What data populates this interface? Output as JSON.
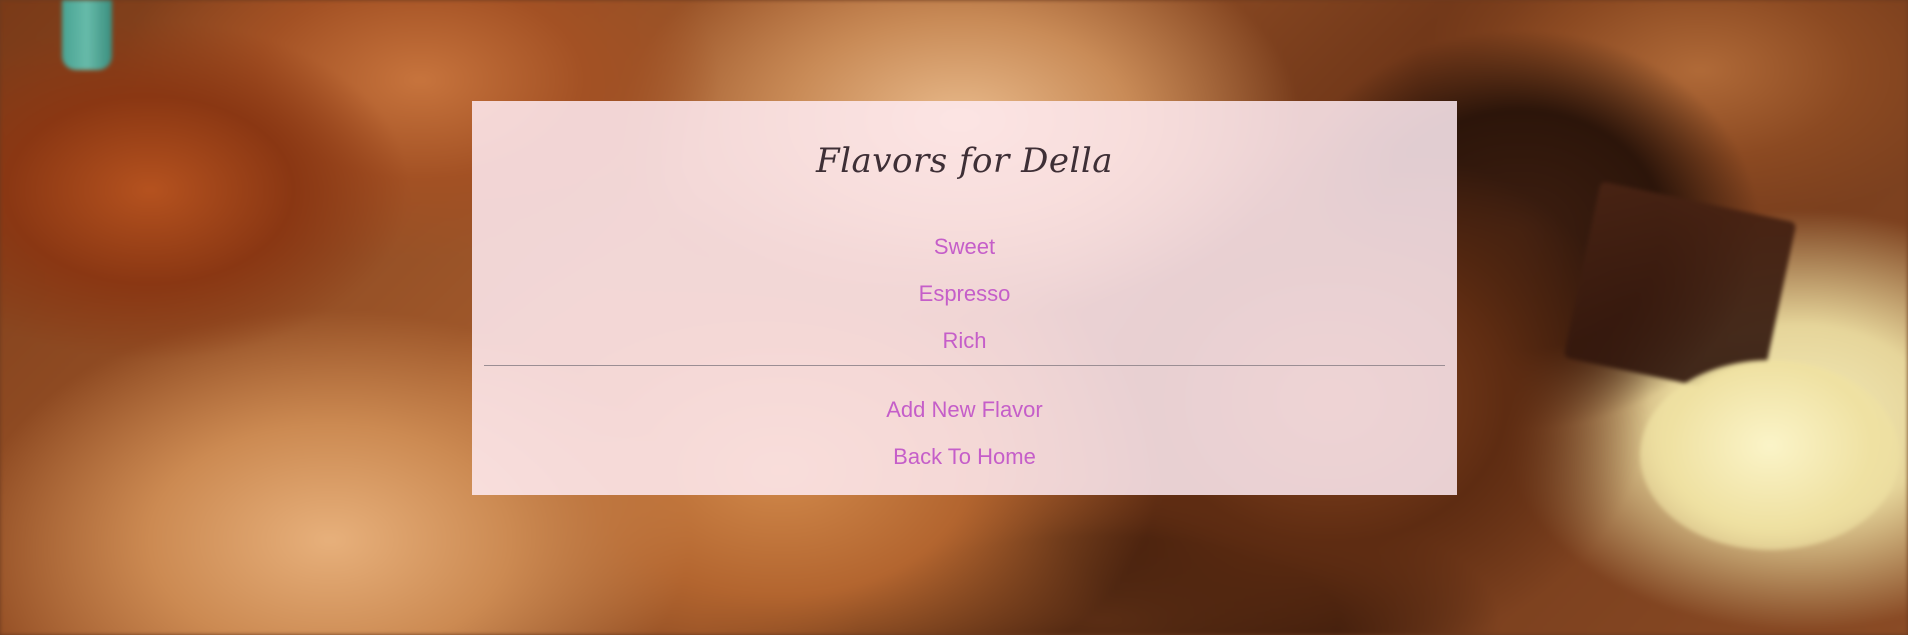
{
  "page": {
    "title": "Flavors for Della"
  },
  "flavors": [
    {
      "label": "Sweet"
    },
    {
      "label": "Espresso"
    },
    {
      "label": "Rich"
    }
  ],
  "actions": {
    "add_flavor_label": "Add New Flavor",
    "back_home_label": "Back To Home"
  },
  "colors": {
    "card_background": "#ffebf2",
    "link": "#c55ec9",
    "title": "#3e2f36"
  }
}
